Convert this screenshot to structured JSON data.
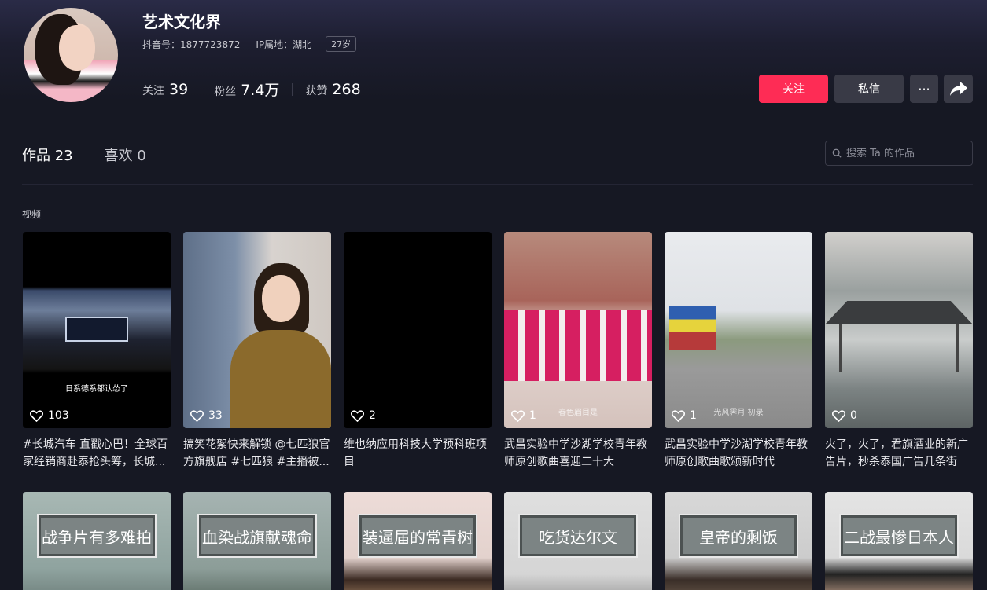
{
  "profile": {
    "name": "艺术文化界",
    "douyin_id": "抖音号：1877723872",
    "ip_location": "IP属地：湖北",
    "age": "27岁",
    "stats": [
      {
        "label": "关注",
        "value": "39"
      },
      {
        "label": "粉丝",
        "value": "7.4万"
      },
      {
        "label": "获赞",
        "value": "268"
      }
    ]
  },
  "actions": {
    "follow": "关注",
    "message": "私信",
    "more": "···"
  },
  "tabs": [
    {
      "label": "作品 23"
    },
    {
      "label": "喜欢 0"
    }
  ],
  "search": {
    "placeholder": "搜索 Ta 的作品"
  },
  "section_label": "视频",
  "videos": [
    {
      "likes": "103",
      "caption": "#长城汽车 直戳心巴！全球百家经销商赴泰抢头筹，长城...",
      "overlay_text": "日系德系都认怂了",
      "watermark": ""
    },
    {
      "likes": "33",
      "caption": "搞笑花絮快来解锁 @七匹狼官方旗舰店 #七匹狼 #主播被...",
      "overlay_text": "",
      "watermark": ""
    },
    {
      "likes": "2",
      "caption": "维也纳应用科技大学预科班项目",
      "overlay_text": "",
      "watermark": ""
    },
    {
      "likes": "1",
      "caption": "武昌实验中学沙湖学校青年教师原创歌曲喜迎二十大",
      "overlay_text": "",
      "watermark": "春色眉目是"
    },
    {
      "likes": "1",
      "caption": "武昌实验中学沙湖学校青年教师原创歌曲歌颂新时代",
      "overlay_text": "",
      "watermark": "光风霁月 初录"
    },
    {
      "likes": "0",
      "caption": "火了，火了，君旗酒业的新广告片，秒杀泰国广告几条街",
      "overlay_text": "",
      "watermark": ""
    }
  ],
  "videos_row2": [
    {
      "title": "战争片有多难拍"
    },
    {
      "title": "血染战旗献魂命"
    },
    {
      "title": "装逼届的常青树"
    },
    {
      "title": "吃货达尔文"
    },
    {
      "title": "皇帝的剩饭"
    },
    {
      "title": "二战最惨日本人"
    }
  ],
  "colors": {
    "accent": "#fe2c55",
    "background": "#161823",
    "button_secondary": "#393a46"
  }
}
